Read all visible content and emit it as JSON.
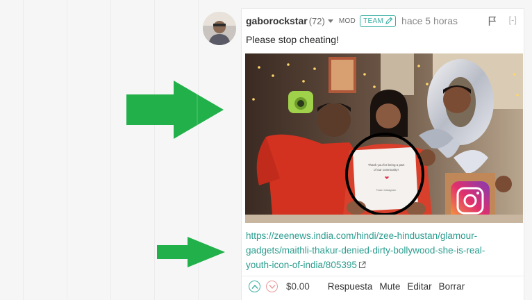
{
  "comment": {
    "author": "gaborockstar",
    "reputation": "(72)",
    "mod_label": "MOD",
    "team_label": "TEAM",
    "time": "hace 5 horas",
    "collapse_label": "[-]",
    "text": "Please stop cheating!",
    "link_lines": [
      "https://zeenews.india.com/hindi/zee-hindustan/glamour-",
      "gadgets/maithli-thakur-denied-dirty-bollywood-she-is-real-",
      "youth-icon-of-india/805395"
    ],
    "payout": "$0.00",
    "actions": [
      "Respuesta",
      "Mute",
      "Editar",
      "Borrar"
    ],
    "photo_card_text": [
      "Thank you for being a part",
      "of our community!",
      "Team Instagram"
    ]
  },
  "icons": [
    "caret-down-icon",
    "pencil-icon",
    "flag-icon",
    "external-link-icon",
    "upvote-icon",
    "downvote-icon",
    "arrow-right-icon"
  ],
  "colors": {
    "accent": "#3ab0a4",
    "link": "#2a9d8f",
    "arrow": "#22b04a",
    "downvote": "#e89c9c",
    "circle_annotation": "#000000"
  }
}
